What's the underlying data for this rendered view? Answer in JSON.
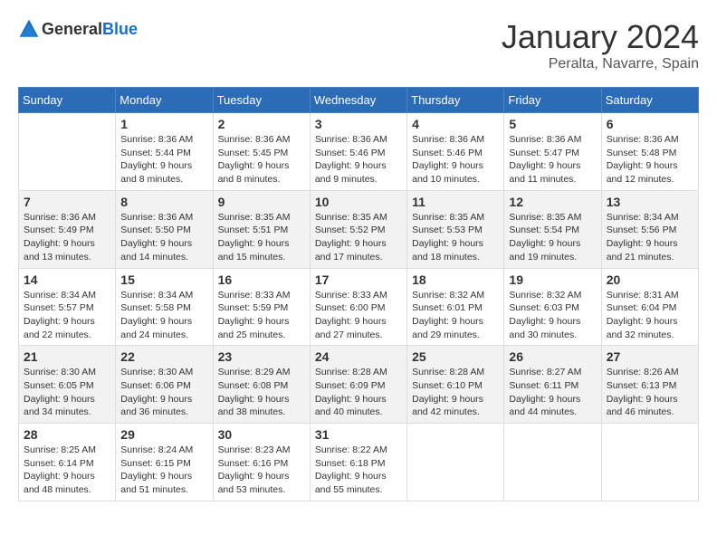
{
  "header": {
    "logo_general": "General",
    "logo_blue": "Blue",
    "month": "January 2024",
    "location": "Peralta, Navarre, Spain"
  },
  "weekdays": [
    "Sunday",
    "Monday",
    "Tuesday",
    "Wednesday",
    "Thursday",
    "Friday",
    "Saturday"
  ],
  "weeks": [
    [
      {
        "day": "",
        "info": ""
      },
      {
        "day": "1",
        "info": "Sunrise: 8:36 AM\nSunset: 5:44 PM\nDaylight: 9 hours\nand 8 minutes."
      },
      {
        "day": "2",
        "info": "Sunrise: 8:36 AM\nSunset: 5:45 PM\nDaylight: 9 hours\nand 8 minutes."
      },
      {
        "day": "3",
        "info": "Sunrise: 8:36 AM\nSunset: 5:46 PM\nDaylight: 9 hours\nand 9 minutes."
      },
      {
        "day": "4",
        "info": "Sunrise: 8:36 AM\nSunset: 5:46 PM\nDaylight: 9 hours\nand 10 minutes."
      },
      {
        "day": "5",
        "info": "Sunrise: 8:36 AM\nSunset: 5:47 PM\nDaylight: 9 hours\nand 11 minutes."
      },
      {
        "day": "6",
        "info": "Sunrise: 8:36 AM\nSunset: 5:48 PM\nDaylight: 9 hours\nand 12 minutes."
      }
    ],
    [
      {
        "day": "7",
        "info": "Sunrise: 8:36 AM\nSunset: 5:49 PM\nDaylight: 9 hours\nand 13 minutes."
      },
      {
        "day": "8",
        "info": "Sunrise: 8:36 AM\nSunset: 5:50 PM\nDaylight: 9 hours\nand 14 minutes."
      },
      {
        "day": "9",
        "info": "Sunrise: 8:35 AM\nSunset: 5:51 PM\nDaylight: 9 hours\nand 15 minutes."
      },
      {
        "day": "10",
        "info": "Sunrise: 8:35 AM\nSunset: 5:52 PM\nDaylight: 9 hours\nand 17 minutes."
      },
      {
        "day": "11",
        "info": "Sunrise: 8:35 AM\nSunset: 5:53 PM\nDaylight: 9 hours\nand 18 minutes."
      },
      {
        "day": "12",
        "info": "Sunrise: 8:35 AM\nSunset: 5:54 PM\nDaylight: 9 hours\nand 19 minutes."
      },
      {
        "day": "13",
        "info": "Sunrise: 8:34 AM\nSunset: 5:56 PM\nDaylight: 9 hours\nand 21 minutes."
      }
    ],
    [
      {
        "day": "14",
        "info": "Sunrise: 8:34 AM\nSunset: 5:57 PM\nDaylight: 9 hours\nand 22 minutes."
      },
      {
        "day": "15",
        "info": "Sunrise: 8:34 AM\nSunset: 5:58 PM\nDaylight: 9 hours\nand 24 minutes."
      },
      {
        "day": "16",
        "info": "Sunrise: 8:33 AM\nSunset: 5:59 PM\nDaylight: 9 hours\nand 25 minutes."
      },
      {
        "day": "17",
        "info": "Sunrise: 8:33 AM\nSunset: 6:00 PM\nDaylight: 9 hours\nand 27 minutes."
      },
      {
        "day": "18",
        "info": "Sunrise: 8:32 AM\nSunset: 6:01 PM\nDaylight: 9 hours\nand 29 minutes."
      },
      {
        "day": "19",
        "info": "Sunrise: 8:32 AM\nSunset: 6:03 PM\nDaylight: 9 hours\nand 30 minutes."
      },
      {
        "day": "20",
        "info": "Sunrise: 8:31 AM\nSunset: 6:04 PM\nDaylight: 9 hours\nand 32 minutes."
      }
    ],
    [
      {
        "day": "21",
        "info": "Sunrise: 8:30 AM\nSunset: 6:05 PM\nDaylight: 9 hours\nand 34 minutes."
      },
      {
        "day": "22",
        "info": "Sunrise: 8:30 AM\nSunset: 6:06 PM\nDaylight: 9 hours\nand 36 minutes."
      },
      {
        "day": "23",
        "info": "Sunrise: 8:29 AM\nSunset: 6:08 PM\nDaylight: 9 hours\nand 38 minutes."
      },
      {
        "day": "24",
        "info": "Sunrise: 8:28 AM\nSunset: 6:09 PM\nDaylight: 9 hours\nand 40 minutes."
      },
      {
        "day": "25",
        "info": "Sunrise: 8:28 AM\nSunset: 6:10 PM\nDaylight: 9 hours\nand 42 minutes."
      },
      {
        "day": "26",
        "info": "Sunrise: 8:27 AM\nSunset: 6:11 PM\nDaylight: 9 hours\nand 44 minutes."
      },
      {
        "day": "27",
        "info": "Sunrise: 8:26 AM\nSunset: 6:13 PM\nDaylight: 9 hours\nand 46 minutes."
      }
    ],
    [
      {
        "day": "28",
        "info": "Sunrise: 8:25 AM\nSunset: 6:14 PM\nDaylight: 9 hours\nand 48 minutes."
      },
      {
        "day": "29",
        "info": "Sunrise: 8:24 AM\nSunset: 6:15 PM\nDaylight: 9 hours\nand 51 minutes."
      },
      {
        "day": "30",
        "info": "Sunrise: 8:23 AM\nSunset: 6:16 PM\nDaylight: 9 hours\nand 53 minutes."
      },
      {
        "day": "31",
        "info": "Sunrise: 8:22 AM\nSunset: 6:18 PM\nDaylight: 9 hours\nand 55 minutes."
      },
      {
        "day": "",
        "info": ""
      },
      {
        "day": "",
        "info": ""
      },
      {
        "day": "",
        "info": ""
      }
    ]
  ]
}
